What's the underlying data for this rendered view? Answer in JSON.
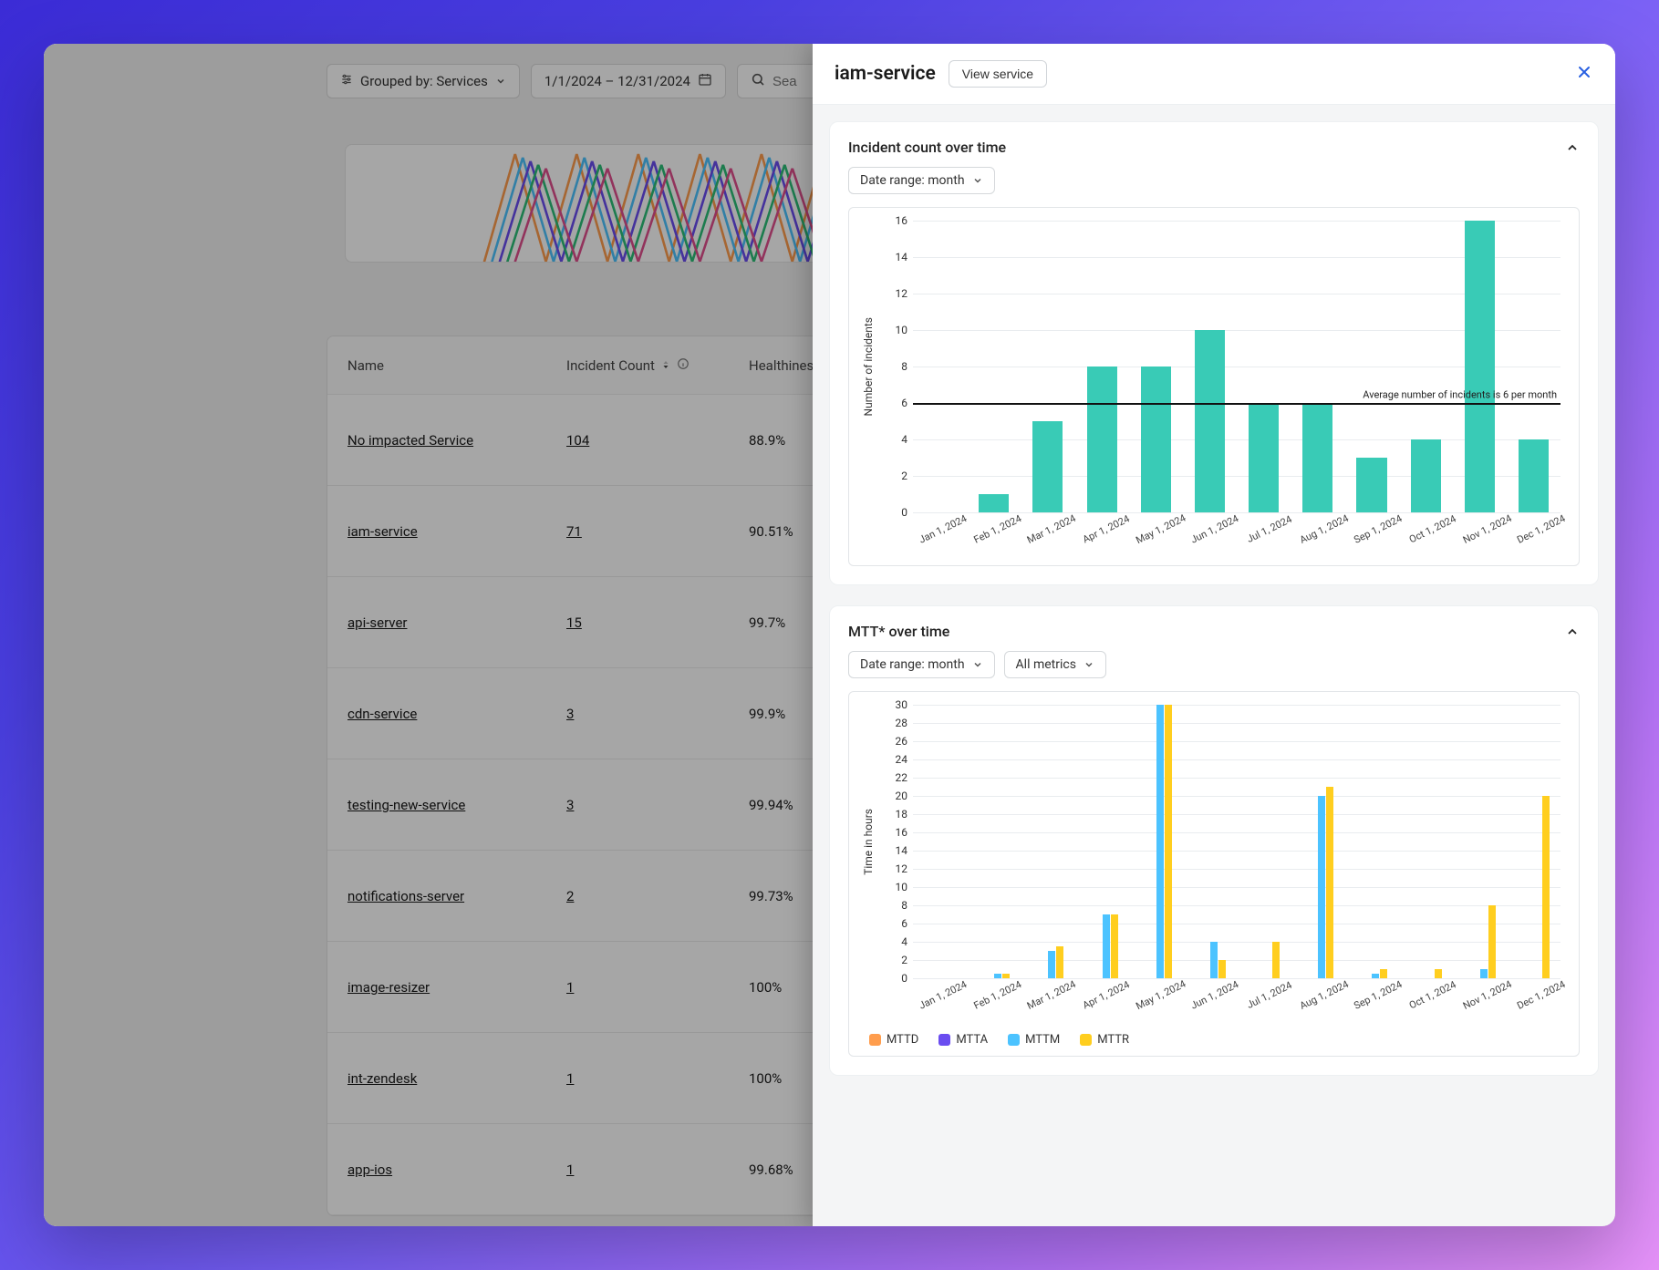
{
  "toolbar": {
    "grouped_by_label": "Grouped by: Services",
    "date_range": "1/1/2024  –  12/31/2024",
    "search_placeholder": "Sea"
  },
  "table": {
    "columns": {
      "name": "Name",
      "incident_count": "Incident Count",
      "healthiness": "Healthiness"
    },
    "rows": [
      {
        "name": "No impacted Service",
        "count": "104",
        "health": "88.9%"
      },
      {
        "name": "iam-service",
        "count": "71",
        "health": "90.51%"
      },
      {
        "name": "api-server",
        "count": "15",
        "health": "99.7%"
      },
      {
        "name": "cdn-service",
        "count": "3",
        "health": "99.9%"
      },
      {
        "name": "testing-new-service",
        "count": "3",
        "health": "99.94%"
      },
      {
        "name": "notifications-server",
        "count": "2",
        "health": "99.73%"
      },
      {
        "name": "image-resizer",
        "count": "1",
        "health": "100%"
      },
      {
        "name": "int-zendesk",
        "count": "1",
        "health": "100%"
      },
      {
        "name": "app-ios",
        "count": "1",
        "health": "99.68%"
      }
    ]
  },
  "panel": {
    "title": "iam-service",
    "view_service_label": "View service"
  },
  "card1": {
    "title": "Incident count over time",
    "range_selector": "Date range: month",
    "y_label": "Number of incidents",
    "avg_text": "Average number of incidents is 6 per month"
  },
  "card2": {
    "title": "MTT* over time",
    "range_selector": "Date range: month",
    "metric_selector": "All metrics",
    "y_label": "Time in hours",
    "legend": {
      "mttd": "MTTD",
      "mtta": "MTTA",
      "mttm": "MTTM",
      "mttr": "MTTR"
    }
  },
  "chart_data": [
    {
      "type": "bar",
      "title": "Incident count over time",
      "ylabel": "Number of incidents",
      "ylim": [
        0,
        16
      ],
      "y_ticks": [
        0,
        2,
        4,
        6,
        8,
        10,
        12,
        14,
        16
      ],
      "average": 6,
      "categories": [
        "Jan 1, 2024",
        "Feb 1, 2024",
        "Mar 1, 2024",
        "Apr 1, 2024",
        "May 1, 2024",
        "Jun 1, 2024",
        "Jul 1, 2024",
        "Aug 1, 2024",
        "Sep 1, 2024",
        "Oct 1, 2024",
        "Nov 1, 2024",
        "Dec 1, 2024"
      ],
      "values": [
        0,
        1,
        5,
        8,
        8,
        10,
        6,
        6,
        3,
        4,
        16,
        4
      ]
    },
    {
      "type": "bar",
      "title": "MTT* over time",
      "ylabel": "Time in hours",
      "ylim": [
        0,
        30
      ],
      "y_ticks": [
        0,
        2,
        4,
        6,
        8,
        10,
        12,
        14,
        16,
        18,
        20,
        22,
        24,
        26,
        28,
        30
      ],
      "categories": [
        "Jan 1, 2024",
        "Feb 1, 2024",
        "Mar 1, 2024",
        "Apr 1, 2024",
        "May 1, 2024",
        "Jun 1, 2024",
        "Jul 1, 2024",
        "Aug 1, 2024",
        "Sep 1, 2024",
        "Oct 1, 2024",
        "Nov 1, 2024",
        "Dec 1, 2024"
      ],
      "series": [
        {
          "name": "MTTD",
          "color": "#ff9d4d",
          "values": [
            0,
            0,
            0,
            0,
            0,
            0,
            0,
            0,
            0,
            0,
            0,
            0
          ]
        },
        {
          "name": "MTTA",
          "color": "#6a4df0",
          "values": [
            0,
            0,
            0,
            0,
            0,
            0,
            0,
            0,
            0,
            0,
            0,
            0
          ]
        },
        {
          "name": "MTTM",
          "color": "#4cc3ff",
          "values": [
            0,
            0.5,
            3,
            7,
            30,
            4,
            0,
            20,
            0.5,
            0,
            1,
            0
          ]
        },
        {
          "name": "MTTR",
          "color": "#ffce1f",
          "values": [
            0,
            0.5,
            3.5,
            7,
            30,
            2,
            4,
            21,
            1,
            1,
            8,
            20
          ]
        }
      ]
    }
  ]
}
